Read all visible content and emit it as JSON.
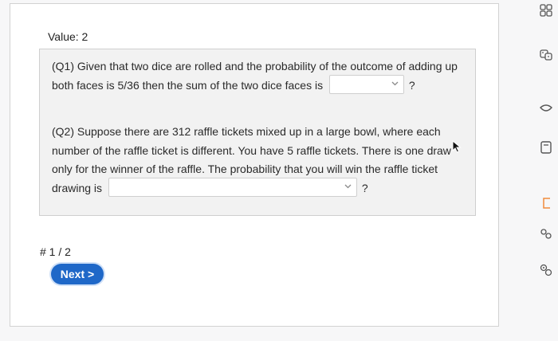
{
  "question": {
    "value_label": "Value: 2",
    "q1": {
      "text_before": "(Q1) Given that two dice are rolled and the probability of the outcome of adding up both faces is 5/36 then the sum of the two dice faces is",
      "select_value": "",
      "text_after": "?"
    },
    "q2": {
      "text_before": "(Q2) Suppose there are 312 raffle tickets mixed up in a large bowl, where each number of the raffle ticket is different. You have 5 raffle tickets. There is one draw only for the winner of the raffle. The probability that you will win the raffle ticket drawing is",
      "select_value": "",
      "text_after": "?"
    }
  },
  "pagination": {
    "counter": "# 1 / 2",
    "next_label": "Next >"
  },
  "icons": {
    "select_chevron": "chevron-down-icon",
    "cursor": "mouse-pointer-icon",
    "rail": [
      "grid-icon",
      "dice-icon",
      "heart-icon",
      "calculator-icon",
      "bracket-icon",
      "people-icon",
      "gear-people-icon"
    ]
  },
  "colors": {
    "accent": "#1f68c8",
    "rail_highlight": "#f08b3c"
  }
}
